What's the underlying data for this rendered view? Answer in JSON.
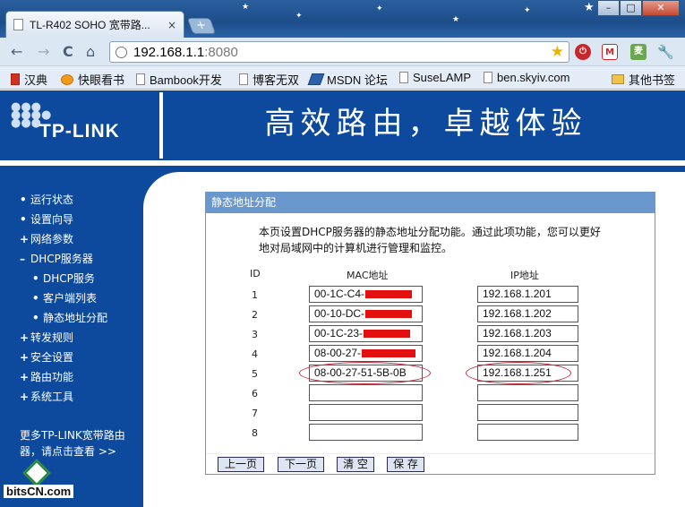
{
  "browser": {
    "tab_title": "TL-R402 SOHO 宽带路...",
    "tab_close": "×",
    "new_tab": "+",
    "url_host": "192.168.1.1",
    "url_port": ":8080",
    "window_buttons": {
      "minimize": "–",
      "maximize": "□",
      "close": "✕"
    },
    "nav": {
      "back": "←",
      "forward": "→",
      "reload": "C",
      "home": "⌂"
    },
    "bookmarks": [
      "汉典",
      "快眼看书",
      "Bambook开发",
      "博客无双",
      "MSDN 论坛",
      "SuseLAMP",
      "ben.skyiv.com"
    ],
    "other_bookmarks": "其他书签",
    "extensions": {
      "gmail": "M",
      "ext_green": "麦"
    }
  },
  "banner": {
    "logo": "TP-LINK",
    "slogan": "高效路由，卓越体验"
  },
  "sidebar": {
    "items": [
      {
        "bullet": "•",
        "label": "运行状态"
      },
      {
        "bullet": "•",
        "label": "设置向导"
      },
      {
        "bullet": "+",
        "label": "网络参数"
      },
      {
        "bullet": "–",
        "label": "DHCP服务器"
      },
      {
        "bullet": "•",
        "label": "DHCP服务"
      },
      {
        "bullet": "•",
        "label": "客户端列表"
      },
      {
        "bullet": "•",
        "label": "静态地址分配"
      },
      {
        "bullet": "+",
        "label": "转发规则"
      },
      {
        "bullet": "+",
        "label": "安全设置"
      },
      {
        "bullet": "+",
        "label": "路由功能"
      },
      {
        "bullet": "+",
        "label": "系统工具"
      }
    ],
    "more_link": "更多TP-LINK宽带路由器，请点击查看 >>"
  },
  "watermark": "bitsCN.com",
  "panel": {
    "title": "静态地址分配",
    "description": "本页设置DHCP服务器的静态地址分配功能。通过此项功能，您可以更好地对局域网中的计算机进行管理和监控。",
    "col_id": "ID",
    "col_mac": "MAC地址",
    "col_ip": "IP地址",
    "rows": [
      {
        "id": "1",
        "mac": "00-1C-C4-",
        "ip": "192.168.1.201"
      },
      {
        "id": "2",
        "mac": "00-10-DC-",
        "ip": "192.168.1.202"
      },
      {
        "id": "3",
        "mac": "00-1C-23-",
        "ip": "192.168.1.203"
      },
      {
        "id": "4",
        "mac": "08-00-27-",
        "ip": "192.168.1.204"
      },
      {
        "id": "5",
        "mac": "08-00-27-51-5B-0B",
        "ip": "192.168.1.251"
      },
      {
        "id": "6",
        "mac": "",
        "ip": ""
      },
      {
        "id": "7",
        "mac": "",
        "ip": ""
      },
      {
        "id": "8",
        "mac": "",
        "ip": ""
      }
    ],
    "buttons": {
      "prev": "上一页",
      "next": "下一页",
      "clear": "清 空",
      "save": "保 存"
    }
  }
}
